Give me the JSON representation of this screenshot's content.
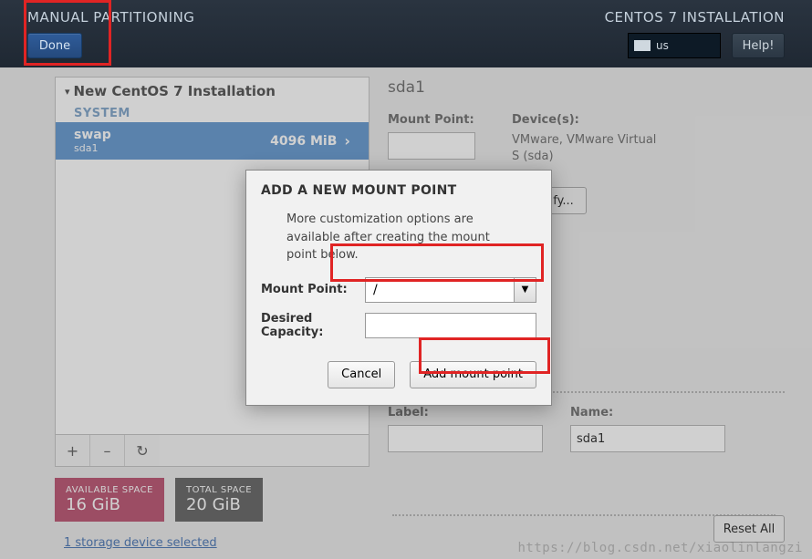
{
  "topbar": {
    "title": "MANUAL PARTITIONING",
    "done": "Done",
    "install_title": "CENTOS 7 INSTALLATION",
    "keyboard": "us",
    "help": "Help!"
  },
  "tree": {
    "header": "New CentOS 7 Installation",
    "system_label": "SYSTEM",
    "partition": {
      "name": "swap",
      "device": "sda1",
      "size": "4096 MiB"
    }
  },
  "toolbar": {
    "plus": "+",
    "minus": "–",
    "reload": "↻"
  },
  "space": {
    "avail_label": "AVAILABLE SPACE",
    "avail_value": "16 GiB",
    "total_label": "TOTAL SPACE",
    "total_value": "20 GiB"
  },
  "storage_link": "1 storage device selected",
  "details": {
    "title": "sda1",
    "mount_label": "Mount Point:",
    "mount_value": "",
    "devices_label": "Device(s):",
    "devices_text": "VMware, VMware Virtual S (sda)",
    "modify": "Modify...",
    "label_label": "Label:",
    "label_value": "",
    "name_label": "Name:",
    "name_value": "sda1"
  },
  "reset": "Reset All",
  "dialog": {
    "title": "ADD A NEW MOUNT POINT",
    "desc": "More customization options are available after creating the mount point below.",
    "mount_label": "Mount Point:",
    "mount_value": "/",
    "cap_label": "Desired Capacity:",
    "cap_value": "",
    "cancel": "Cancel",
    "add": "Add mount point"
  },
  "watermark": "https://blog.csdn.net/xiaolinlangzi"
}
